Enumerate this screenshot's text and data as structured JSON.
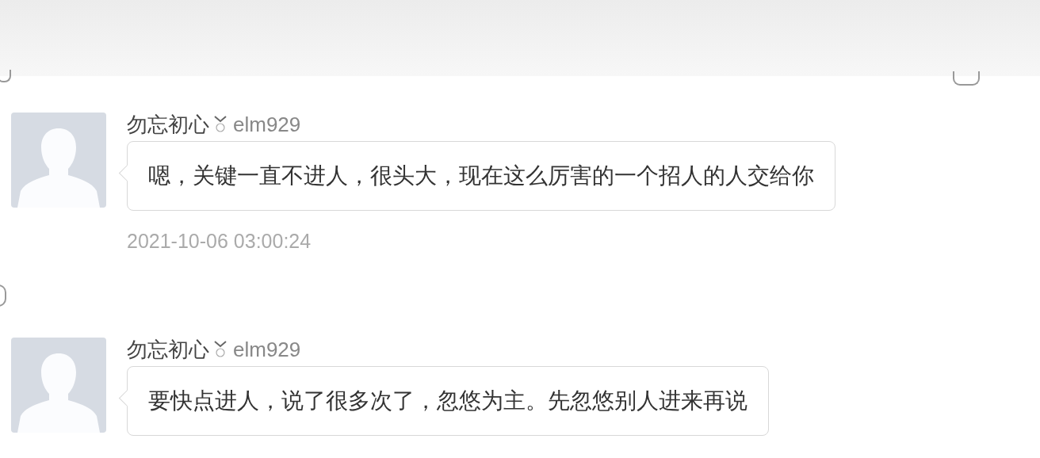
{
  "messages": [
    {
      "sender": "勿忘初心",
      "username": "elm929",
      "text": "嗯，关键一直不进人，很头大，现在这么厉害的一个招人的人交给你",
      "time": "2021-10-06 03:00:24"
    },
    {
      "sender": "勿忘初心",
      "username": "elm929",
      "text": "要快点进人，说了很多次了，忽悠为主。先忽悠别人进来再说"
    }
  ]
}
